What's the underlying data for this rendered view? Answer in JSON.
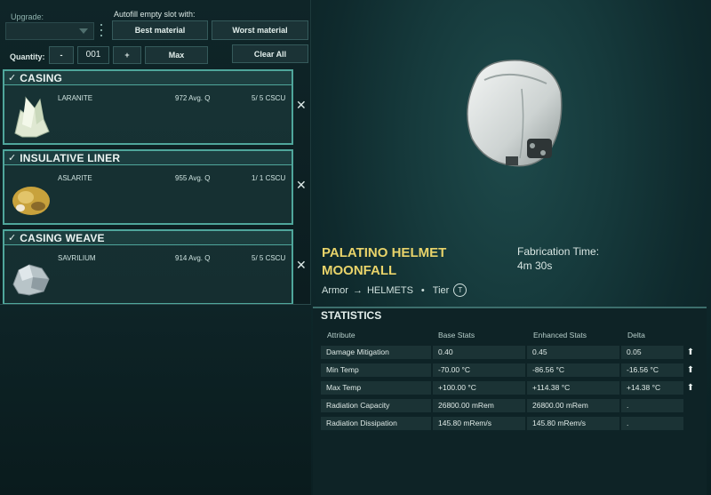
{
  "controls": {
    "upgrade_label": "Upgrade:",
    "upgrade_value": "",
    "autofill_label": "Autofill empty slot with:",
    "best_material": "Best material",
    "worst_material": "Worst material",
    "quantity_label": "Quantity:",
    "minus": "-",
    "quantity_value": "001",
    "plus": "+",
    "max": "Max",
    "clear_all": "Clear All"
  },
  "slots": [
    {
      "title": "CASING",
      "material": "LARANITE",
      "quality": "972 Avg. Q",
      "scu": "5/ 5 CSCU",
      "ore_color": "#dfe8d2"
    },
    {
      "title": "INSULATIVE LINER",
      "material": "ASLARITE",
      "quality": "955 Avg. Q",
      "scu": "1/ 1 CSCU",
      "ore_color": "#c8a23c"
    },
    {
      "title": "CASING WEAVE",
      "material": "SAVRILIUM",
      "quality": "914 Avg. Q",
      "scu": "5/ 5 CSCU",
      "ore_color": "#b8c4c8"
    }
  ],
  "icons": {
    "check": "✓",
    "close": "✕",
    "arrow": "→",
    "up": "⬆"
  },
  "item": {
    "name_line1": "PALATINO HELMET",
    "name_line2": "MOONFALL",
    "fab_label": "Fabrication Time:",
    "fab_time": "4m 30s",
    "category": "Armor",
    "subcategory": "HELMETS",
    "tier_label": "Tier",
    "tier_badge": "T"
  },
  "stats": {
    "title": "STATISTICS",
    "headers": [
      "Attribute",
      "Base Stats",
      "Enhanced Stats",
      "Delta"
    ],
    "rows": [
      {
        "attribute": "Damage Mitigation",
        "base": "0.40",
        "enhanced": "0.45",
        "delta": "0.05",
        "up": true
      },
      {
        "attribute": "Min Temp",
        "base": "-70.00 °C",
        "enhanced": "-86.56 °C",
        "delta": "-16.56 °C",
        "up": true
      },
      {
        "attribute": "Max Temp",
        "base": "+100.00 °C",
        "enhanced": "+114.38 °C",
        "delta": "+14.38 °C",
        "up": true
      },
      {
        "attribute": "Radiation Capacity",
        "base": "26800.00 mRem",
        "enhanced": "26800.00 mRem",
        "delta": ".",
        "up": false
      },
      {
        "attribute": "Radiation Dissipation",
        "base": "145.80 mRem/s",
        "enhanced": "145.80 mRem/s",
        "delta": ".",
        "up": false
      }
    ]
  },
  "colors": {
    "accent_yellow": "#e8d36a",
    "slot_border": "#4fa69b"
  }
}
